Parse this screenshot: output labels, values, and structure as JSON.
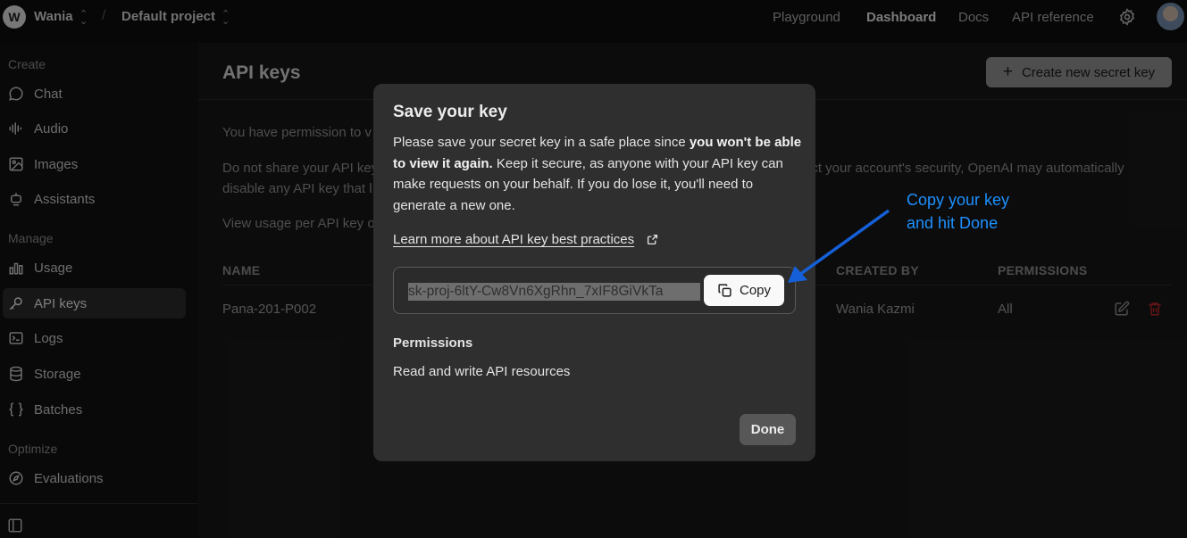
{
  "topbar": {
    "org_initial": "W",
    "org_name": "Wania",
    "project_name": "Default project",
    "nav": [
      "Playground",
      "Dashboard",
      "Docs",
      "API reference"
    ],
    "active_nav": "Dashboard"
  },
  "sidebar": {
    "sections": [
      {
        "title": "Create",
        "items": [
          {
            "label": "Chat",
            "icon": "chat-icon"
          },
          {
            "label": "Audio",
            "icon": "audio-icon"
          },
          {
            "label": "Images",
            "icon": "image-icon"
          },
          {
            "label": "Assistants",
            "icon": "assistant-icon"
          }
        ]
      },
      {
        "title": "Manage",
        "items": [
          {
            "label": "Usage",
            "icon": "usage-icon"
          },
          {
            "label": "API keys",
            "icon": "key-icon",
            "active": true
          },
          {
            "label": "Logs",
            "icon": "terminal-icon"
          },
          {
            "label": "Storage",
            "icon": "database-icon"
          },
          {
            "label": "Batches",
            "icon": "braces-icon"
          }
        ]
      },
      {
        "title": "Optimize",
        "items": [
          {
            "label": "Evaluations",
            "icon": "compass-icon"
          }
        ]
      }
    ]
  },
  "main": {
    "title": "API keys",
    "create_button": "Create new secret key",
    "para1": "You have permission to v",
    "para2_line1": "Do not share your API key",
    "para2_line1_right": "ect your account's security, OpenAI may automatically",
    "para2_line2": "disable any API key that l",
    "para3": "View usage per API key o",
    "table": {
      "headers": [
        "NAME",
        "CREATED BY",
        "PERMISSIONS"
      ],
      "rows": [
        {
          "name": "Pana-201-P002",
          "created_by": "Wania Kazmi",
          "permissions": "All"
        }
      ]
    }
  },
  "modal": {
    "title": "Save your key",
    "body_prefix": "Please save your secret key in a safe place since ",
    "body_bold": "you won't be able to view it again.",
    "body_suffix": " Keep it secure, as anyone with your API key can make requests on your behalf. If you do lose it, you'll need to generate a new one.",
    "learn_link": "Learn more about API key best practices",
    "key_value": "sk-proj-6ltY-Cw8Vn6XgRhn_7xIF8GiVkTa",
    "copy_label": "Copy",
    "permissions_title": "Permissions",
    "permissions_value": "Read and write API resources",
    "done_label": "Done"
  },
  "annotation": {
    "line1": "Copy your key",
    "line2": "and hit Done",
    "color": "#1e90ff"
  }
}
